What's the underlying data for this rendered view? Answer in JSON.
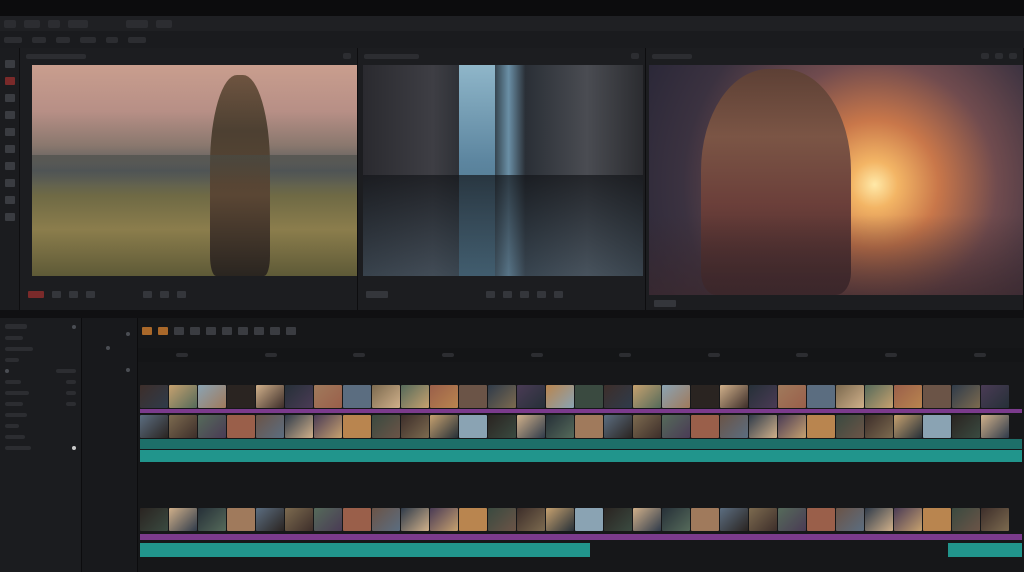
{
  "colors": {
    "accent_teal": "#21958c",
    "accent_purple": "#7b3b8c",
    "panel_bg": "#1c1d20"
  },
  "viewers": [
    {
      "scene": "man-standing-on-hillside-at-dusk"
    },
    {
      "scene": "reflected-city-street"
    },
    {
      "scene": "woman-in-sunset-backlight"
    }
  ],
  "icons": [
    "play-icon",
    "scissors-icon",
    "marker-icon",
    "settings-icon",
    "eye-icon",
    "mute-icon",
    "lock-icon"
  ],
  "timeline": {
    "clip_palette": [
      "#3d2e2a",
      "#6b5447",
      "#a07a5c",
      "#c6a16f",
      "#2f3b4a",
      "#5b6d80",
      "#8aa3b3",
      "#4a3b55",
      "#7c6a4f",
      "#2a2421",
      "#b9854f",
      "#556a5a",
      "#d0b08a",
      "#3a4a40",
      "#9a5f4a",
      "#263038"
    ],
    "bottom_teal_segments": 2
  }
}
